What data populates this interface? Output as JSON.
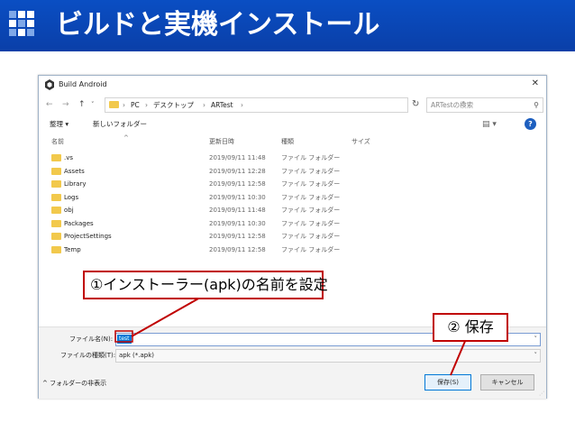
{
  "slide": {
    "title": "ビルドと実機インストール",
    "header_color": "#0a47b9",
    "logo_icon": "grid-squares-icon"
  },
  "dialog": {
    "title": "Build Android",
    "title_icon": "unity-logo-icon",
    "close": "✕",
    "nav": {
      "back": "←",
      "forward": "→",
      "up": "↑"
    },
    "breadcrumb": [
      "PC",
      "デスクトップ",
      "ARTest"
    ],
    "breadcrumb_sep": "›",
    "search_placeholder": "ARTestの検索",
    "toolbar": {
      "organize": "整理 ▾",
      "new_folder": "新しいフォルダー"
    },
    "columns": {
      "name": "名前",
      "modified": "更新日時",
      "type": "種類",
      "size": "サイズ"
    },
    "files": [
      {
        "name": ".vs",
        "modified": "2019/09/11 11:48",
        "type": "ファイル フォルダー"
      },
      {
        "name": "Assets",
        "modified": "2019/09/11 12:28",
        "type": "ファイル フォルダー"
      },
      {
        "name": "Library",
        "modified": "2019/09/11 12:58",
        "type": "ファイル フォルダー"
      },
      {
        "name": "Logs",
        "modified": "2019/09/11 10:30",
        "type": "ファイル フォルダー"
      },
      {
        "name": "obj",
        "modified": "2019/09/11 11:48",
        "type": "ファイル フォルダー"
      },
      {
        "name": "Packages",
        "modified": "2019/09/11 10:30",
        "type": "ファイル フォルダー"
      },
      {
        "name": "ProjectSettings",
        "modified": "2019/09/11 12:58",
        "type": "ファイル フォルダー"
      },
      {
        "name": "Temp",
        "modified": "2019/09/11 12:58",
        "type": "ファイル フォルダー"
      }
    ],
    "filename_label": "ファイル名(N):",
    "filename_value": "test",
    "filetype_label": "ファイルの種類(T):",
    "filetype_value": "apk (*.apk)",
    "hide_folders": "^ フォルダーの非表示",
    "save_button": "保存(S)",
    "cancel_button": "キャンセル"
  },
  "annotations": {
    "callout1": "①インストーラー(apk)の名前を設定",
    "callout2": "② 保存",
    "color": "#c00000"
  }
}
